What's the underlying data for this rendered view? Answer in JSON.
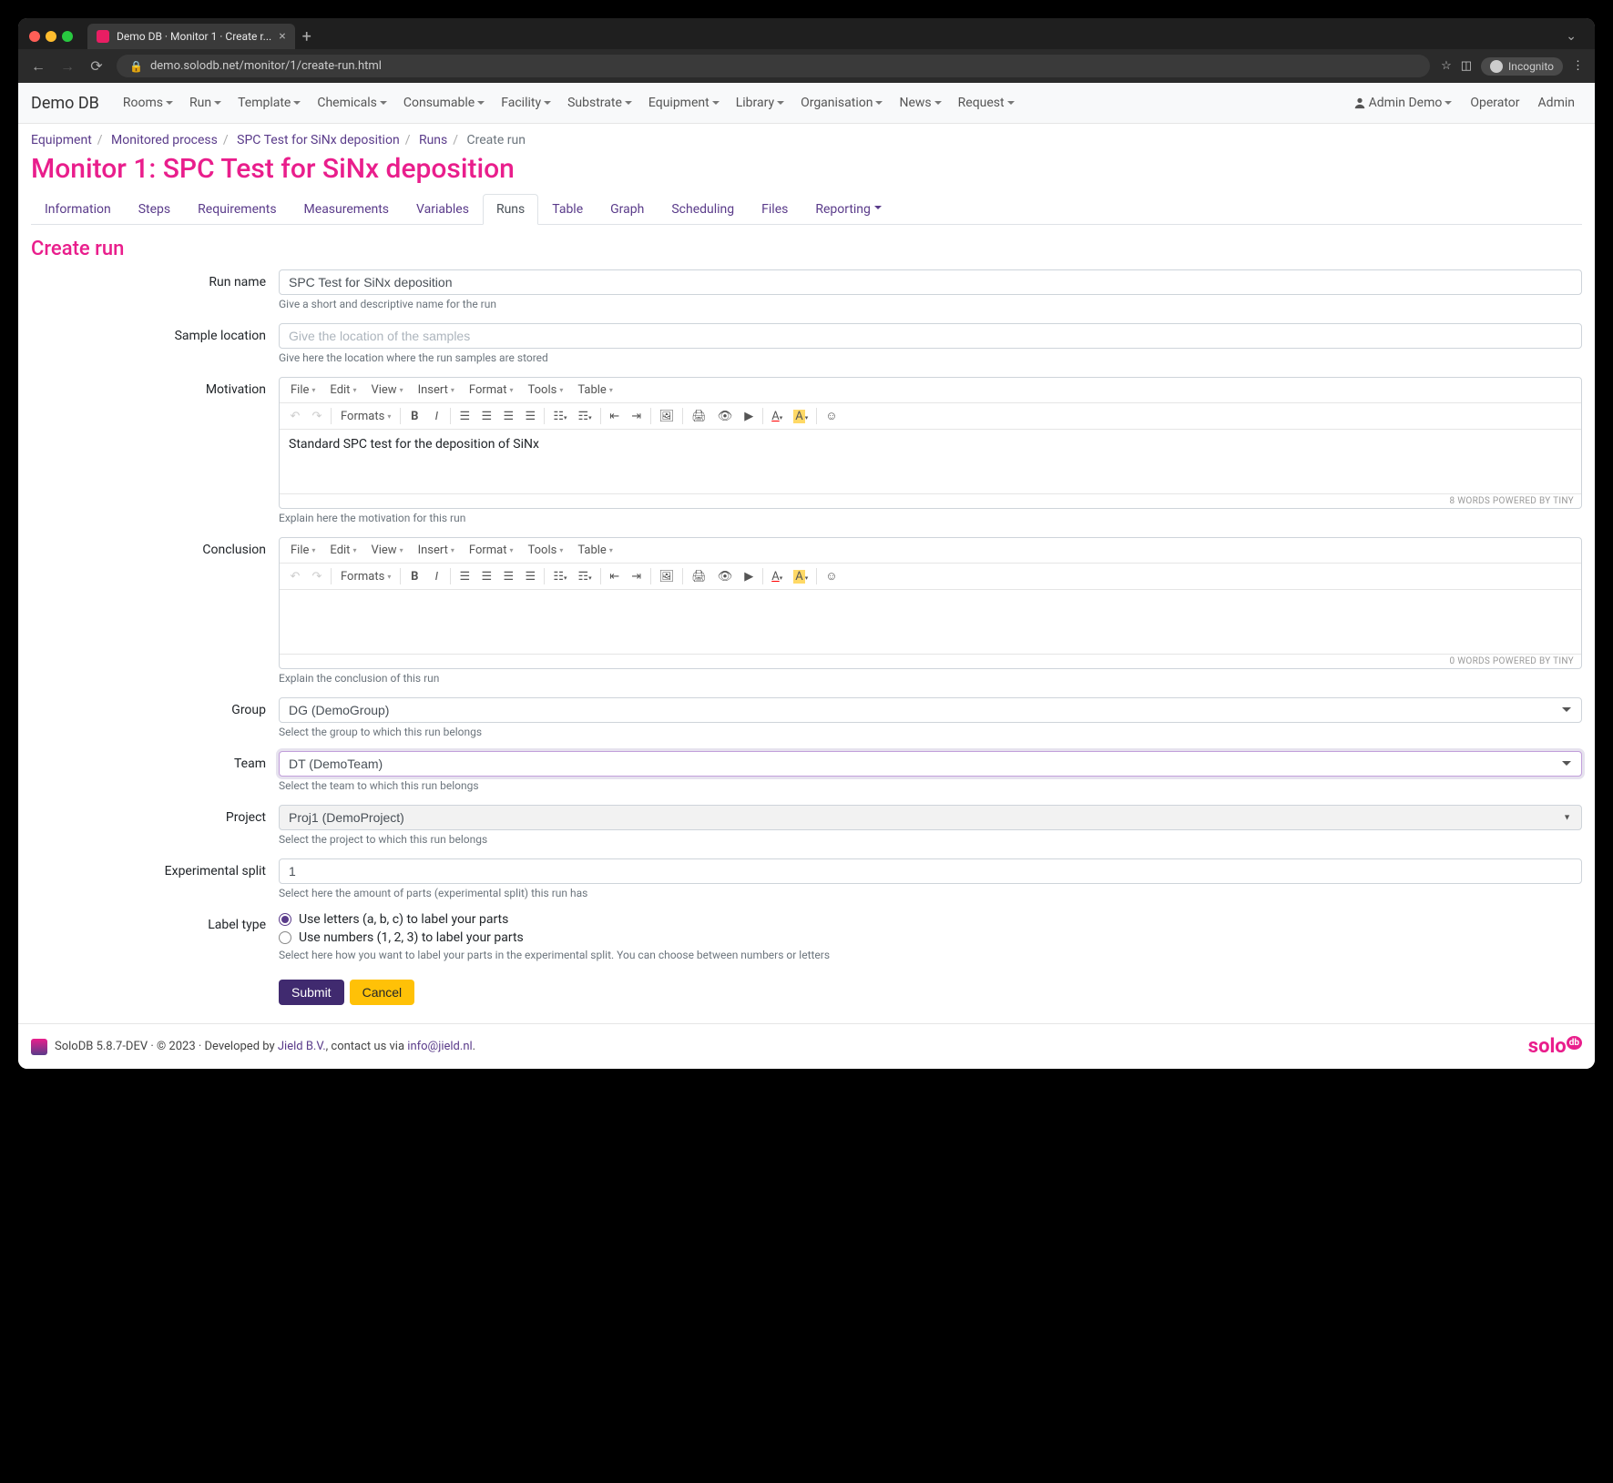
{
  "browser": {
    "tab_title": "Demo DB · Monitor 1 · Create r...",
    "url": "demo.solodb.net/monitor/1/create-run.html",
    "incognito": "Incognito"
  },
  "nav": {
    "brand": "Demo DB",
    "menu": [
      "Rooms",
      "Run",
      "Template",
      "Chemicals",
      "Consumable",
      "Facility",
      "Substrate",
      "Equipment",
      "Library",
      "Organisation",
      "News",
      "Request"
    ],
    "user": "Admin Demo",
    "right": [
      "Operator",
      "Admin"
    ]
  },
  "breadcrumb": [
    "Equipment",
    "Monitored process",
    "SPC Test for SiNx deposition",
    "Runs",
    "Create run"
  ],
  "page_title": "Monitor 1: SPC Test for SiNx deposition",
  "tabs": [
    "Information",
    "Steps",
    "Requirements",
    "Measurements",
    "Variables",
    "Runs",
    "Table",
    "Graph",
    "Scheduling",
    "Files",
    "Reporting"
  ],
  "active_tab": "Runs",
  "section_title": "Create run",
  "form": {
    "run_name": {
      "label": "Run name",
      "value": "SPC Test for SiNx deposition",
      "help": "Give a short and descriptive name for the run"
    },
    "sample_location": {
      "label": "Sample location",
      "placeholder": "Give the location of the samples",
      "help": "Give here the location where the run samples are stored"
    },
    "motivation": {
      "label": "Motivation",
      "content": "Standard SPC test for the deposition of SiNx",
      "status": "8 WORDS POWERED BY TINY",
      "help": "Explain here the motivation for this run"
    },
    "conclusion": {
      "label": "Conclusion",
      "content": "",
      "status": "0 WORDS POWERED BY TINY",
      "help": "Explain the conclusion of this run"
    },
    "group": {
      "label": "Group",
      "value": "DG (DemoGroup)",
      "help": "Select the group to which this run belongs"
    },
    "team": {
      "label": "Team",
      "value": "DT (DemoTeam)",
      "help": "Select the team to which this run belongs"
    },
    "project": {
      "label": "Project",
      "value": "Proj1 (DemoProject)",
      "help": "Select the project to which this run belongs"
    },
    "split": {
      "label": "Experimental split",
      "value": "1",
      "help": "Select here the amount of parts (experimental split) this run has"
    },
    "label_type": {
      "label": "Label type",
      "option1": "Use letters (a, b, c) to label your parts",
      "option2": "Use numbers (1, 2, 3) to label your parts",
      "help": "Select here how you want to label your parts in the experimental split. You can choose between numbers or letters"
    }
  },
  "tinymce": {
    "menus": [
      "File",
      "Edit",
      "View",
      "Insert",
      "Format",
      "Tools",
      "Table"
    ],
    "formats": "Formats"
  },
  "buttons": {
    "submit": "Submit",
    "cancel": "Cancel"
  },
  "footer": {
    "text1": "SoloDB 5.8.7-DEV · © 2023 · Developed by ",
    "link1": "Jield B.V.",
    "text2": ", contact us via ",
    "link2": "info@jield.nl",
    "logo": "solo"
  }
}
